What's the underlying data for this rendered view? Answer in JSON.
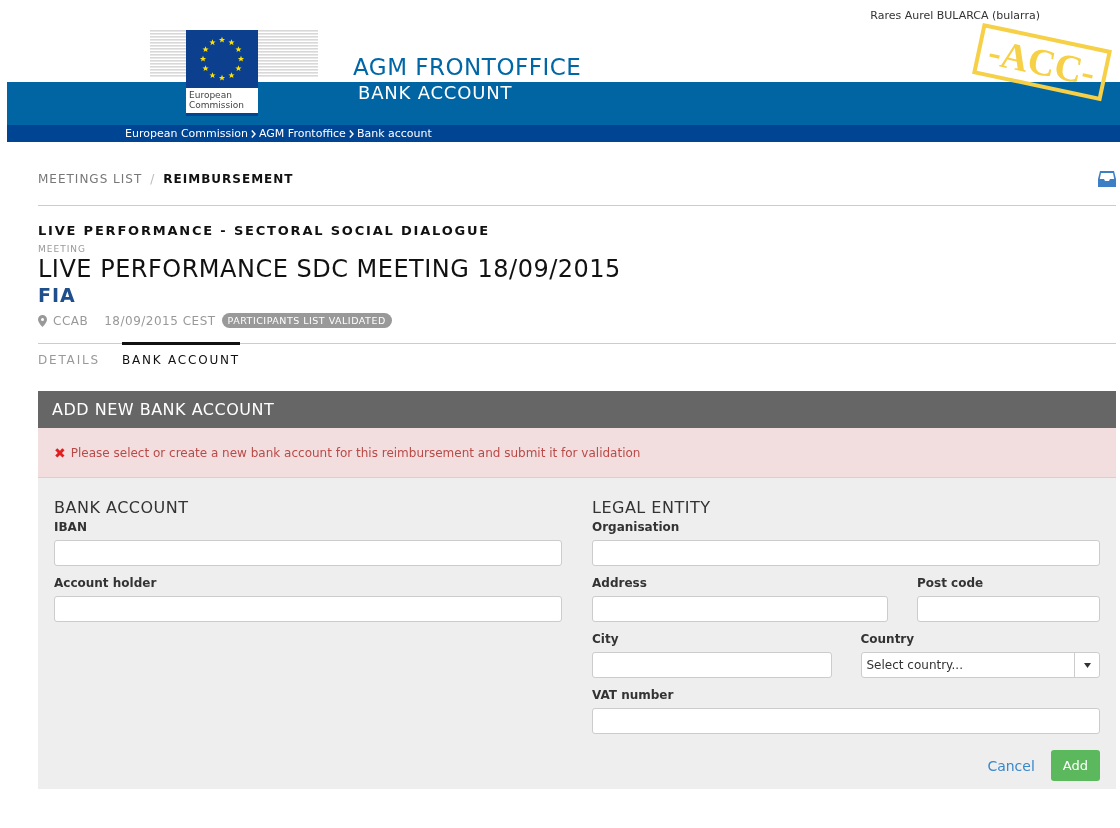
{
  "header": {
    "user": "Rares Aurel BULARCA (bularra)",
    "stamp": "-ACC-",
    "logo_lines": [
      "European",
      "Commission"
    ],
    "app_title": "AGM FRONTOFFICE",
    "page_title": "BANK ACCOUNT",
    "breadcrumb": [
      "European Commission",
      "AGM Frontoffice",
      "Bank account"
    ]
  },
  "nav": {
    "items": [
      {
        "label": "MEETINGS LIST",
        "selected": false
      },
      {
        "label": "REIMBURSEMENT",
        "selected": true
      }
    ],
    "separator": "/"
  },
  "meeting": {
    "group": "LIVE PERFORMANCE - SECTORAL SOCIAL DIALOGUE",
    "type_label": "MEETING",
    "title": "LIVE PERFORMANCE SDC MEETING 18/09/2015",
    "organisation": "FIA",
    "location": "CCAB",
    "date": "18/09/2015 CEST",
    "status_badge": "PARTICIPANTS LIST VALIDATED"
  },
  "tabs": [
    {
      "label": "DETAILS",
      "selected": false
    },
    {
      "label": "BANK ACCOUNT",
      "selected": true
    }
  ],
  "form": {
    "title": "ADD NEW BANK ACCOUNT",
    "alert": {
      "icon": "✖",
      "message": "Please select or create a new bank account for this reimbursement and submit it for validation"
    },
    "sections": [
      {
        "title": "BANK ACCOUNT",
        "rows": [
          [
            {
              "label": "IBAN",
              "kind": "text"
            }
          ],
          [
            {
              "label": "Account holder",
              "kind": "text"
            }
          ]
        ]
      },
      {
        "title": "LEGAL ENTITY",
        "rows": [
          [
            {
              "label": "Organisation",
              "kind": "text"
            }
          ],
          [
            {
              "label": "Address",
              "kind": "text"
            },
            {
              "label": "Post code",
              "kind": "text"
            }
          ],
          [
            {
              "label": "City",
              "kind": "text"
            },
            {
              "label": "Country",
              "kind": "select",
              "placeholder": "Select country..."
            }
          ],
          [
            {
              "label": "VAT number",
              "kind": "text"
            }
          ]
        ]
      }
    ],
    "cancel": "Cancel",
    "submit": "Add"
  }
}
